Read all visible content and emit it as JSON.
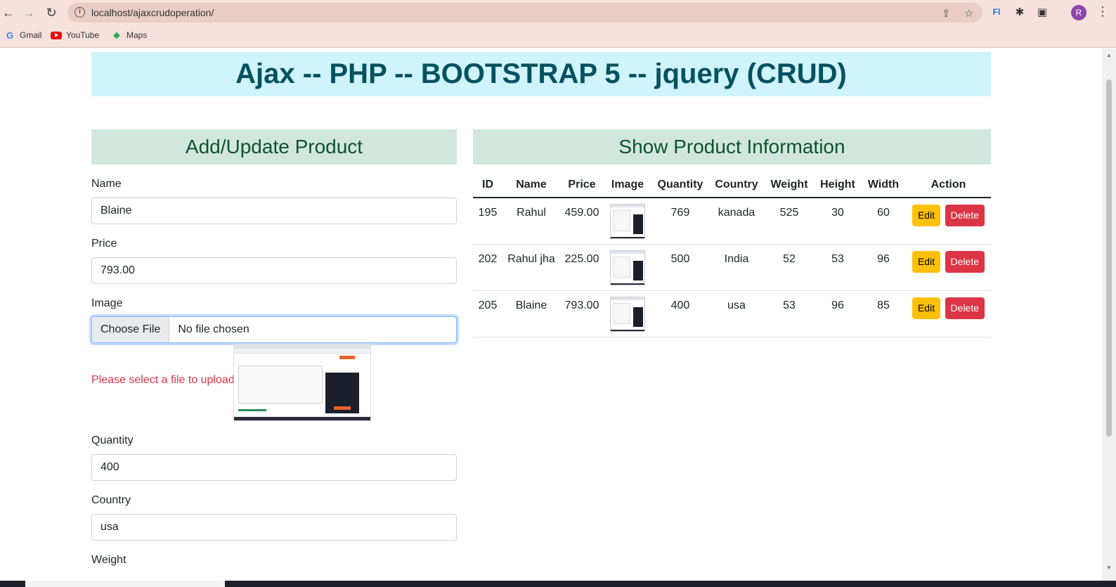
{
  "browser": {
    "url": "localhost/ajaxcrudoperation/",
    "profile_initial": "R",
    "bookmarks": [
      {
        "label": "Gmail",
        "icon": "google-icon"
      },
      {
        "label": "YouTube",
        "icon": "youtube-icon"
      },
      {
        "label": "Maps",
        "icon": "maps-icon"
      }
    ]
  },
  "page": {
    "title": "Ajax -- PHP -- BOOTSTRAP 5 -- jquery (CRUD)"
  },
  "form": {
    "heading": "Add/Update Product",
    "name_label": "Name",
    "name_value": "Blaine",
    "price_label": "Price",
    "price_value": "793.00",
    "image_label": "Image",
    "choose_file": "Choose File",
    "no_file": "No file chosen",
    "error": "Please select a file to upload",
    "quantity_label": "Quantity",
    "quantity_value": "400",
    "country_label": "Country",
    "country_value": "usa",
    "weight_label": "Weight"
  },
  "table": {
    "heading": "Show Product Information",
    "columns": [
      "ID",
      "Name",
      "Price",
      "Image",
      "Quantity",
      "Country",
      "Weight",
      "Height",
      "Width",
      "Action"
    ],
    "rows": [
      {
        "id": "195",
        "name": "Rahul",
        "price": "459.00",
        "quantity": "769",
        "country": "kanada",
        "weight": "525",
        "height": "30",
        "width": "60"
      },
      {
        "id": "202",
        "name": "Rahul jha",
        "price": "225.00",
        "quantity": "500",
        "country": "India",
        "weight": "52",
        "height": "53",
        "width": "96"
      },
      {
        "id": "205",
        "name": "Blaine",
        "price": "793.00",
        "quantity": "400",
        "country": "usa",
        "weight": "53",
        "height": "96",
        "width": "85"
      }
    ],
    "edit_label": "Edit",
    "delete_label": "Delete"
  },
  "colors": {
    "title_bg": "#cff4fc",
    "title_text": "#055160",
    "section_bg": "#d1e7dd",
    "section_text": "#0f5132",
    "edit_btn": "#ffc107",
    "delete_btn": "#dc3545",
    "error_text": "#dc3545"
  }
}
